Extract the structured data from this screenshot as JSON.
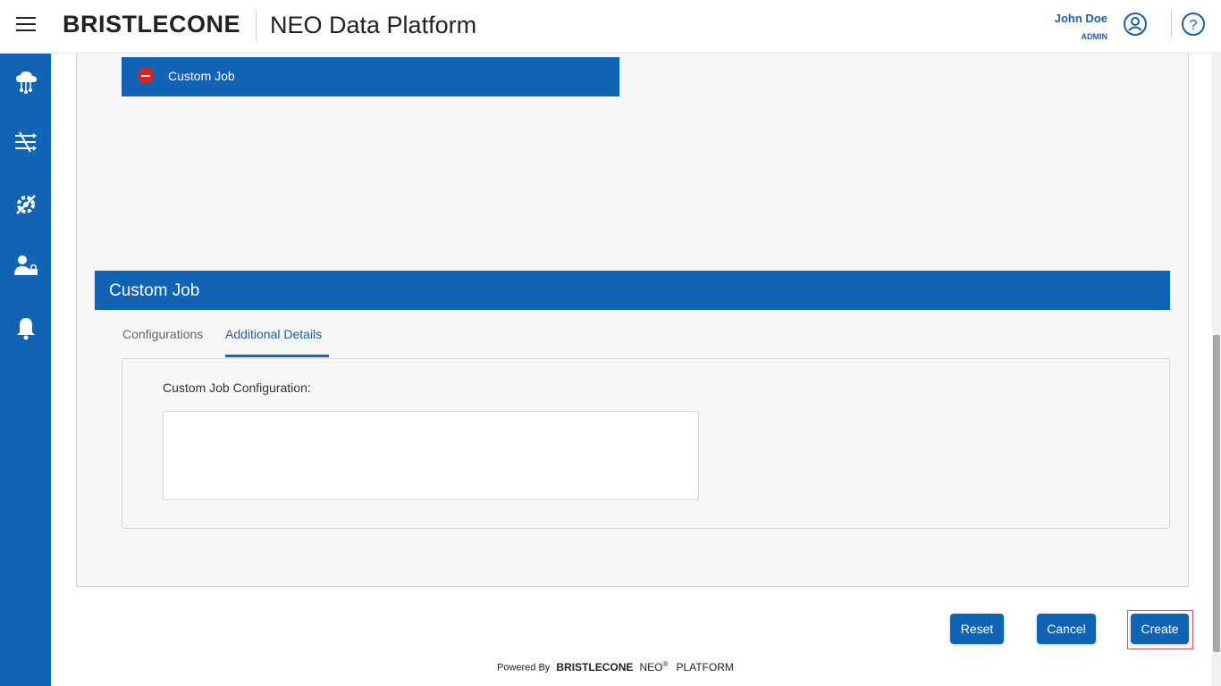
{
  "header": {
    "brand": "BRISTLECONE",
    "app_title": "NEO Data Platform",
    "user_name": "John Doe",
    "user_role": "ADMIN"
  },
  "sidebar": {
    "items": [
      {
        "icon": "cloud-network-icon"
      },
      {
        "icon": "pipeline-flow-icon"
      },
      {
        "icon": "gear-wrench-icon"
      },
      {
        "icon": "user-lock-icon"
      },
      {
        "icon": "bell-icon"
      }
    ]
  },
  "job_bar": {
    "label": "Custom Job",
    "status_icon": "stop-icon",
    "status_color": "#e02020"
  },
  "section": {
    "title": "Custom Job"
  },
  "tabs": [
    {
      "label": "Configurations",
      "active": false
    },
    {
      "label": "Additional Details",
      "active": true
    }
  ],
  "form": {
    "config_label": "Custom Job Configuration:",
    "config_value": ""
  },
  "buttons": {
    "reset": "Reset",
    "cancel": "Cancel",
    "create": "Create"
  },
  "footer": {
    "powered_by": "Powered By",
    "brand": "BRISTLECONE",
    "neo": "NEO",
    "registered": "®",
    "platform": "PLATFORM"
  },
  "colors": {
    "primary": "#1163b6",
    "link": "#1c5ea8"
  }
}
